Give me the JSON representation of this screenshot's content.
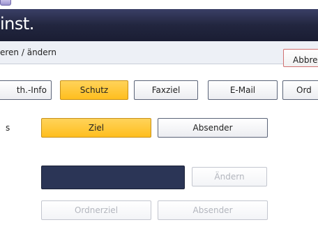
{
  "header": {
    "title": "inst."
  },
  "subheader": {
    "text": "eren / ändern"
  },
  "cancel_button": {
    "label": "Abbre"
  },
  "tabs": [
    {
      "label": "th.-Info",
      "active": false
    },
    {
      "label": "Schutz",
      "active": true
    },
    {
      "label": "Faxziel",
      "active": false
    },
    {
      "label": "E-Mail",
      "active": false
    },
    {
      "label": "Ord",
      "active": false
    }
  ],
  "row": {
    "label": "s",
    "options": [
      {
        "label": "Ziel",
        "selected": true
      },
      {
        "label": "Absender",
        "selected": false
      }
    ]
  },
  "field": {
    "value": "",
    "change_button": {
      "label": "Ändern",
      "enabled": false
    }
  },
  "bottom_buttons": [
    {
      "label": "Ordnerziel",
      "enabled": false
    },
    {
      "label": "Absender",
      "enabled": false
    }
  ],
  "colors": {
    "titlebar": "#22263f",
    "accent_active": "#ffc72c",
    "field_dark": "#2b3556",
    "cancel_border": "#d07070"
  }
}
